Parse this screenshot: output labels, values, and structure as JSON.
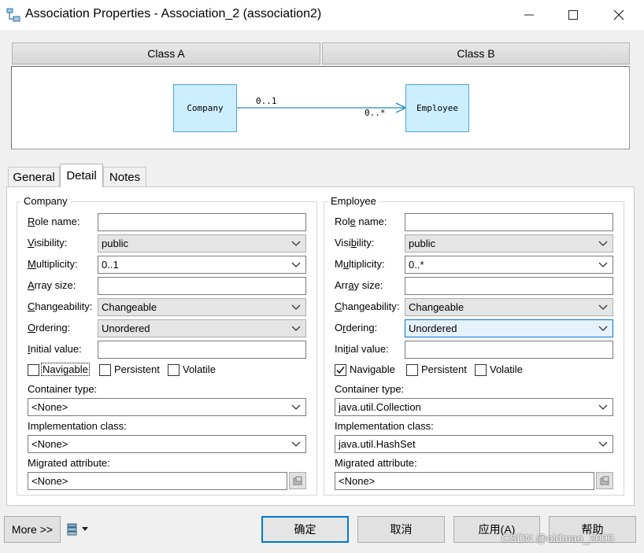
{
  "window": {
    "title": "Association Properties - Association_2 (association2)",
    "minimize": "—",
    "maximize": "☐",
    "close": "✕"
  },
  "header": {
    "class_a": "Class A",
    "class_b": "Class B"
  },
  "diagram": {
    "left_class": "Company",
    "right_class": "Employee",
    "left_multiplicity": "0..1",
    "right_multiplicity": "0..*"
  },
  "tabs": [
    {
      "label": "General"
    },
    {
      "label": "Detail"
    },
    {
      "label": "Notes"
    }
  ],
  "active_tab": "Detail",
  "groups": [
    {
      "title": "Company",
      "labels": {
        "role_name": "Role name:",
        "visibility": "Visibility:",
        "multiplicity": "Multiplicity:",
        "array_size": "Array size:",
        "changeability": "Changeability:",
        "ordering": "Ordering:",
        "initial_value": "Initial value:",
        "container_type": "Container type:",
        "implementation_class": "Implementation class:",
        "migrated_attribute": "Migrated attribute:"
      },
      "role_name": "",
      "visibility": "public",
      "multiplicity": "0..1",
      "array_size": "",
      "changeability": "Changeable",
      "ordering": "Unordered",
      "initial_value": "",
      "navigable_label": "Navigable",
      "navigable": false,
      "persistent_label": "Persistent",
      "persistent": false,
      "volatile_label": "Volatile",
      "volatile": false,
      "container_type": "<None>",
      "implementation_class": "<None>",
      "migrated_attribute": "<None>"
    },
    {
      "title": "Employee",
      "labels": {
        "role_name": "Role name:",
        "visibility": "Visibility:",
        "multiplicity": "Multiplicity:",
        "array_size": "Array size:",
        "changeability": "Changeability:",
        "ordering": "Ordering:",
        "initial_value": "Initial value:",
        "container_type": "Container type:",
        "implementation_class": "Implementation class:",
        "migrated_attribute": "Migrated attribute:"
      },
      "role_name": "",
      "visibility": "public",
      "multiplicity": "0..*",
      "array_size": "",
      "changeability": "Changeable",
      "ordering": "Unordered",
      "initial_value": "",
      "navigable_label": "Navigable",
      "navigable": true,
      "persistent_label": "Persistent",
      "persistent": false,
      "volatile_label": "Volatile",
      "volatile": false,
      "container_type": "java.util.Collection",
      "implementation_class": "java.util.HashSet",
      "migrated_attribute": "<None>"
    }
  ],
  "footer": {
    "more": "More >>",
    "ok": "确定",
    "cancel": "取消",
    "apply": "应用(A)",
    "help": "帮助"
  },
  "watermark": "CSDN @oldmao_2000",
  "colors": {
    "accent": "#0078d7",
    "class_fill": "#cceeff",
    "class_border": "#4ea6d8",
    "association_line": "#1e8ac8"
  },
  "icons": {
    "app": "association-icon",
    "tools_menu": "toolbar-menu-icon",
    "browse": "properties-icon"
  }
}
